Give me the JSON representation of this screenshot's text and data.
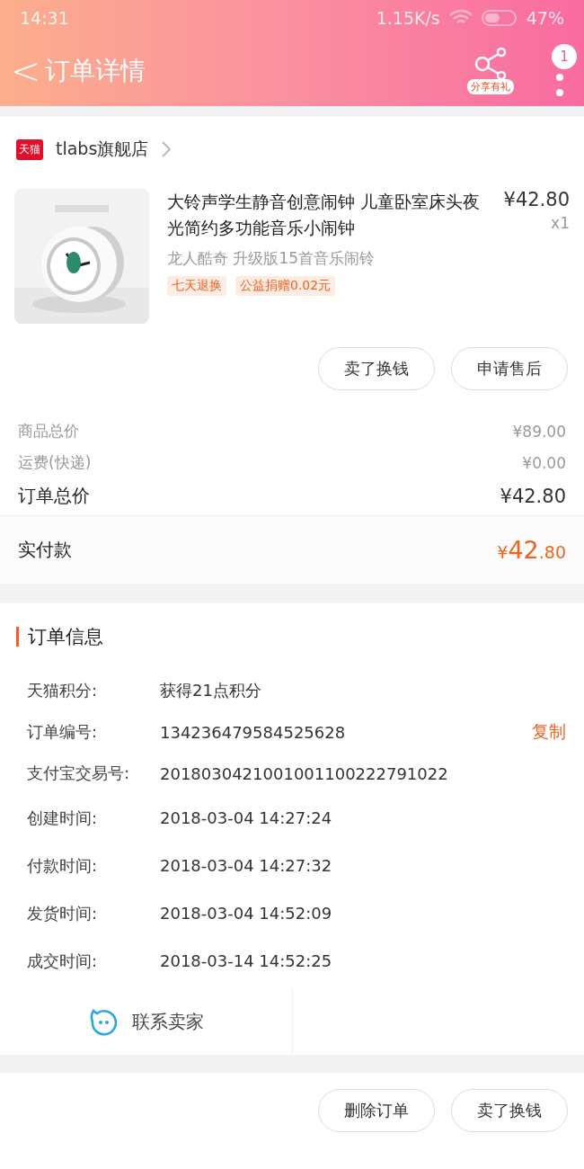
{
  "status_bar": {
    "time": "14:31",
    "speed": "1.15K/s",
    "battery": "47%"
  },
  "header": {
    "back": "<",
    "title": "订单详情",
    "share_badge": "分享有礼",
    "notification_count": "1"
  },
  "shop": {
    "badge": "天猫",
    "name": "tlabs旗舰店"
  },
  "product": {
    "image": {
      "kind": "picture"
    },
    "title": "大铃声学生静音创意闹钟 儿童卧室床头夜光简约多功能音乐小闹钟",
    "price": "¥42.80",
    "quantity": "x1",
    "spec": "龙人酷奇 升级版15首音乐闹铃",
    "tags": [
      "七天退换",
      "公益捐赠0.02元"
    ]
  },
  "item_actions": [
    "卖了换钱",
    "申请售后"
  ],
  "price_rows": [
    {
      "label": "商品总价",
      "value": "¥89.00",
      "kind": "minor"
    },
    {
      "label": "运费(快递)",
      "value": "¥0.00",
      "kind": "minor"
    },
    {
      "label": "订单总价",
      "value": "¥42.80",
      "kind": "major"
    }
  ],
  "paid": {
    "label": "实付款",
    "currency": "¥",
    "integer": "42",
    "decimal": ".80"
  },
  "order_info": {
    "title": "订单信息",
    "rows": [
      {
        "label": "天猫积分:",
        "value": "获得21点积分"
      },
      {
        "label": "订单编号:",
        "value": "134236479584525628",
        "action": "复制"
      },
      {
        "label": "支付宝交易号:",
        "value": "2018030421001001100222791022"
      },
      {
        "label": "创建时间:",
        "value": "2018-03-04 14:27:24"
      },
      {
        "label": "付款时间:",
        "value": "2018-03-04 14:27:32"
      },
      {
        "label": "发货时间:",
        "value": "2018-03-04 14:52:09"
      },
      {
        "label": "成交时间:",
        "value": "2018-03-14 14:52:25"
      }
    ],
    "contact": "联系卖家"
  },
  "bottom_actions": [
    "删除订单",
    "卖了换钱"
  ]
}
